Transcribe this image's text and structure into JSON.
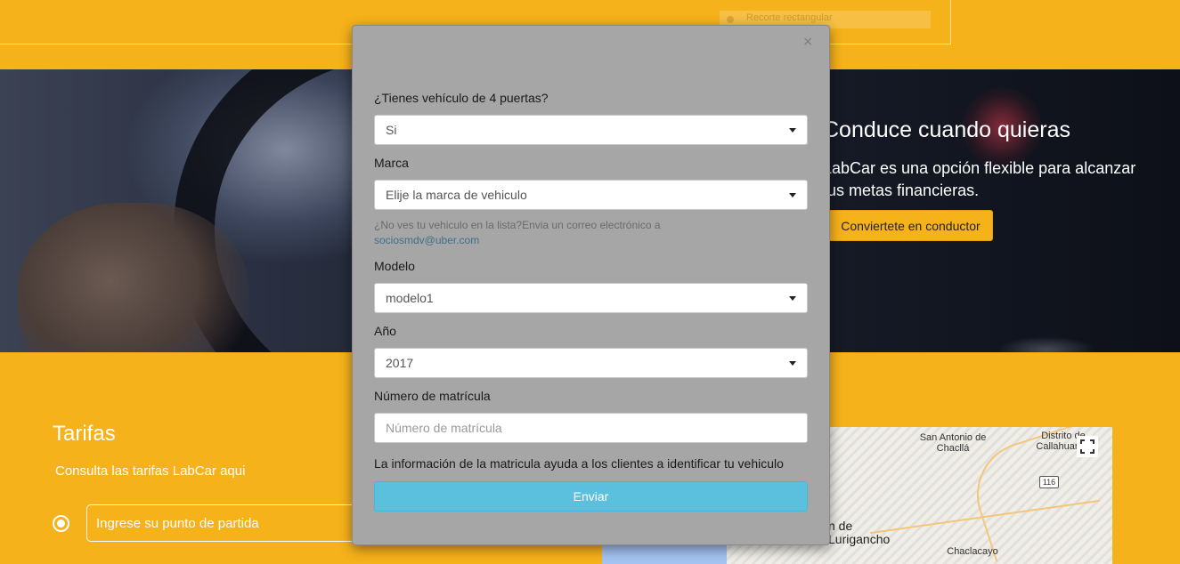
{
  "background": {
    "ghost_chip_label": "Recorte rectangular",
    "hero": {
      "title": "Conduce cuando quieras",
      "text": "LabCar es una opción flexible para alcanzar tus metas financieras.",
      "button": "Conviertete en conductor"
    },
    "tarifas": {
      "title": "Tarifas",
      "subtitle": "Consulta las tarifas LabCar aqui",
      "origin_placeholder": "Ingrese su punto de partida"
    },
    "map": {
      "labels": [
        "San Antonio de Chacllá",
        "Distrito de Callahuanca",
        "Chaclacayo",
        "n de Lurigancho"
      ],
      "route_shield": "116"
    }
  },
  "modal": {
    "close": "×",
    "q_vehicle_label": "¿Tienes vehículo de 4 puertas?",
    "q_vehicle_value": "Si",
    "brand_label": "Marca",
    "brand_value": "Elije la marca de vehiculo",
    "help_text": "¿No ves tu vehiculo en la lista?Envia un correo electrónico a ",
    "help_email": "sociosmdv@uber.com",
    "model_label": "Modelo",
    "model_value": "modelo1",
    "year_label": "Año",
    "year_value": "2017",
    "plate_label": "Número de matrícula",
    "plate_placeholder": "Número de matrícula",
    "info_text": "La información de la matricula ayuda a los clientes a identificar tu vehiculo",
    "submit": "Enviar"
  },
  "colors": {
    "page_yellow": "#F6B21B",
    "modal_gray": "#a6a6a6",
    "submit_blue": "#5bc0de"
  }
}
